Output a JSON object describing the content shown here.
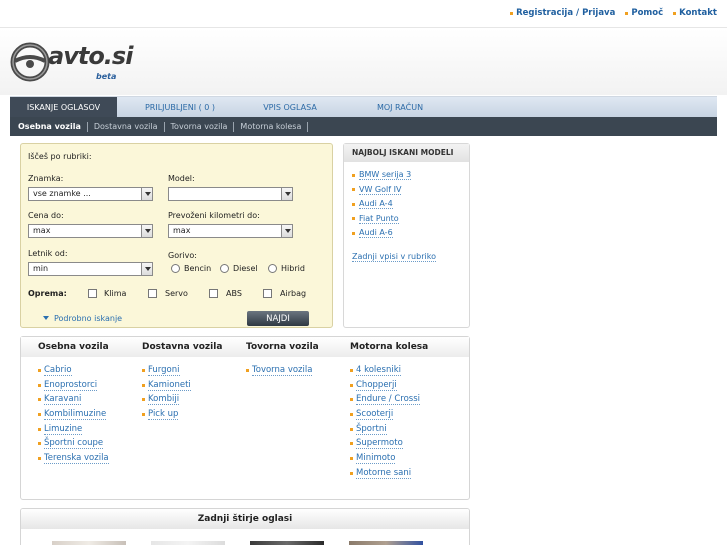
{
  "top_links": [
    "Registracija / Prijava",
    "Pomoč",
    "Kontakt"
  ],
  "logo": {
    "text": "avto.si",
    "beta": "beta"
  },
  "tabs": [
    "ISKANJE OGLASOV",
    "PRILJUBLJENI ( 0 )",
    "VPIS OGLASA",
    "MOJ RAČUN"
  ],
  "subnav": [
    "Osebna vozila",
    "Dostavna vozila",
    "Tovorna vozila",
    "Motorna kolesa"
  ],
  "search": {
    "heading": "Iščeš po rubriki:",
    "znamka_label": "Znamka:",
    "znamka_value": "vse znamke ...",
    "model_label": "Model:",
    "model_value": "",
    "cena_label": "Cena do:",
    "cena_value": "max",
    "km_label": "Prevoženi kilometri do:",
    "km_value": "max",
    "letnik_label": "Letnik od:",
    "letnik_value": "min",
    "gorivo_label": "Gorivo:",
    "gorivo_options": [
      "Bencin",
      "Diesel",
      "Hibrid"
    ],
    "oprema_label": "Oprema:",
    "oprema_options": [
      "Klima",
      "Servo",
      "ABS",
      "Airbag"
    ],
    "advanced_link": "Podrobno iskanje",
    "submit": "NAJDI"
  },
  "popular": {
    "heading": "NAJBOLJ ISKANI MODELI",
    "items": [
      "BMW serija 3",
      "VW Golf IV",
      "Audi A-4",
      "Fiat Punto",
      "Audi A-6"
    ],
    "last_link": "Zadnji vpisi v rubriko"
  },
  "categories": [
    {
      "title": "Osebna vozila",
      "items": [
        "Cabrio",
        "Enoprostorci",
        "Karavani",
        "Kombilimuzine",
        "Limuzine",
        "Športni coupe",
        "Terenska vozila"
      ]
    },
    {
      "title": "Dostavna vozila",
      "items": [
        "Furgoni",
        "Kamioneti",
        "Kombiji",
        "Pick up"
      ]
    },
    {
      "title": "Tovorna vozila",
      "items": [
        "Tovorna vozila"
      ]
    },
    {
      "title": "Motorna kolesa",
      "items": [
        "4 kolesniki",
        "Chopperji",
        "Endure / Crossi",
        "Scooterji",
        "Športni",
        "Supermoto",
        "Minimoto",
        "Motorne sani"
      ]
    }
  ],
  "last_four": {
    "heading": "Zadnji štirje oglasi"
  },
  "colors": {
    "link": "#2a6fb0",
    "accent_bullet": "#f0a020",
    "search_bg": "#fbf7d9",
    "nav_dark": "#3b4651"
  }
}
